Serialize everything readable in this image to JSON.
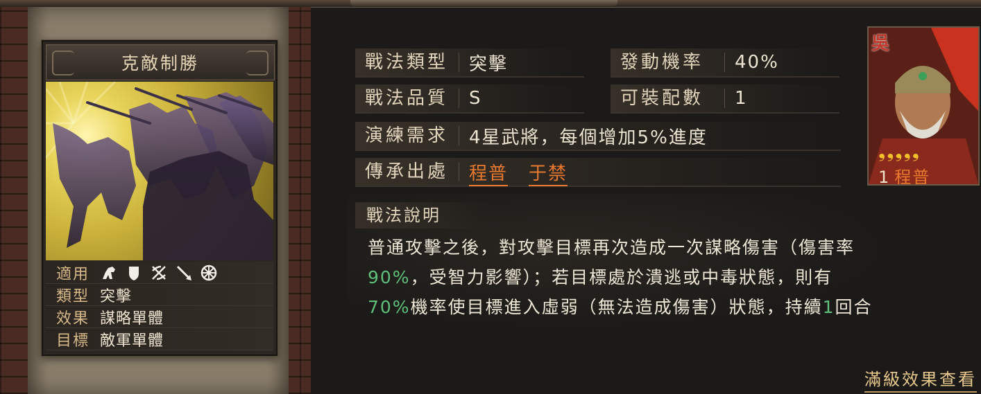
{
  "skill_card": {
    "title": "克敵制勝",
    "rows": [
      {
        "key": "適用",
        "value": ""
      },
      {
        "key": "類型",
        "value": "突擊"
      },
      {
        "key": "效果",
        "value": "謀略單體"
      },
      {
        "key": "目標",
        "value": "敵軍單體"
      }
    ],
    "unit_icons": [
      "cavalry-icon",
      "shield-icon",
      "crossed-bows-icon",
      "spear-icon",
      "wheel-icon"
    ]
  },
  "info": {
    "type_label": "戰法類型",
    "type_value": "突擊",
    "rate_label": "發動機率",
    "rate_value": "40%",
    "quality_label": "戰法品質",
    "quality_value": "S",
    "slots_label": "可裝配數",
    "slots_value": "1",
    "train_label": "演練需求",
    "train_value": "4星武將，每個增加5%進度",
    "inherit_label": "傳承出處",
    "inherit_sources": [
      "程普",
      "于禁"
    ]
  },
  "description": {
    "title": "戰法說明",
    "p1": "普通攻擊之後，對攻擊目標再次造成一次謀略傷害（傷害率",
    "hl1": "90%",
    "p2": "，受智力影響）；若目標處於潰逃或中毒狀態，則有",
    "hl2": "70%",
    "p3": "機率使目標進入虛弱（無法造成傷害）狀態，持續",
    "hl3": "1",
    "p4": "回合"
  },
  "full_effect_link": "滿級效果查看",
  "general": {
    "kingdom": "吳",
    "stars": 5,
    "star_glyphs": "❟❟❟❟❟",
    "count": "1",
    "name": "程普"
  },
  "colors": {
    "highlight_green": "#5fc07a",
    "inherit_orange": "#e8792e",
    "star_gold": "#f3c22b",
    "kingdom_red": "#c0392b"
  }
}
